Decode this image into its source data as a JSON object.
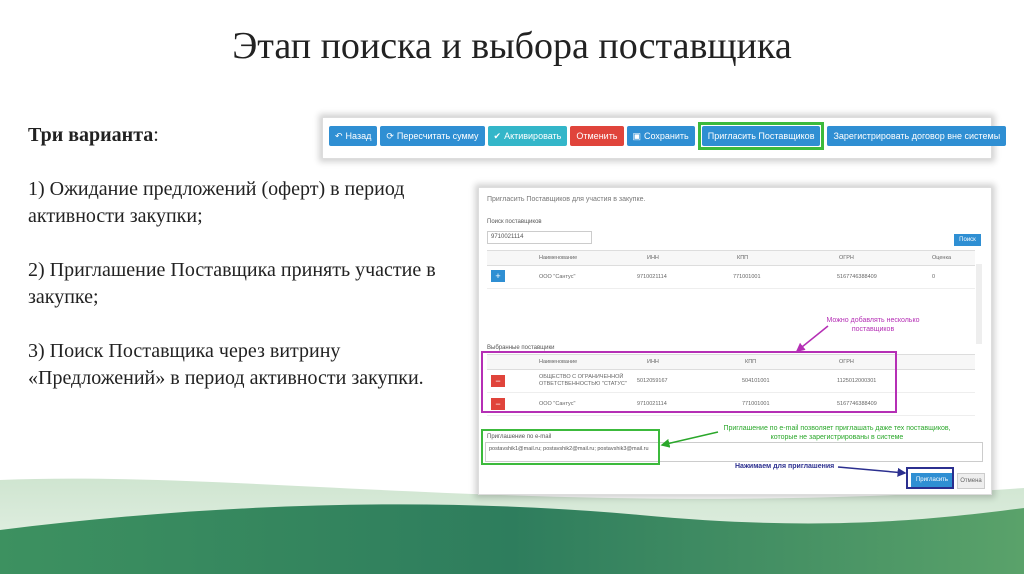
{
  "slide": {
    "title": "Этап поиска и выбора поставщика",
    "heading": "Три варианта",
    "heading_suffix": ":",
    "items": [
      "1) Ожидание предложений (оферт) в период активности закупки;",
      "2) Приглашение Поставщика принять участие в закупке;",
      "3) Поиск Поставщика через витрину «Предложений» в период активности закупки."
    ]
  },
  "toolbar": {
    "back": "Назад",
    "recalc": "Пересчитать сумму",
    "activate": "Активировать",
    "cancel": "Отменить",
    "save": "Сохранить",
    "invite": "Пригласить Поставщиков",
    "register": "Зарегистрировать договор вне системы"
  },
  "dialog": {
    "title": "Пригласить Поставщиков для участия в закупке.",
    "search_label": "Поиск поставщиков",
    "search_value": "9710021114",
    "search_button": "Поиск",
    "columns": [
      "Наименование",
      "ИНН",
      "КПП",
      "ОГРН",
      "Оценка"
    ],
    "results": [
      {
        "name": "ООО \"Сантус\"",
        "inn": "9710021114",
        "kpp": "771001001",
        "ogrn": "5167746388409",
        "score": "0"
      }
    ],
    "selected_label": "Выбранные поставщики",
    "selected_columns": [
      "Наименование",
      "ИНН",
      "КПП",
      "ОГРН"
    ],
    "selected": [
      {
        "name_line1": "ОБЩЕСТВО С ОГРАНИЧЕННОЙ",
        "name_line2": "ОТВЕТСТВЕННОСТЬЮ \"СТАТУС\"",
        "inn": "5012059167",
        "kpp": "504101001",
        "ogrn": "1125012000301"
      },
      {
        "name_line1": "ООО \"Сантус\"",
        "name_line2": "",
        "inn": "9710021114",
        "kpp": "771001001",
        "ogrn": "5167746388409"
      }
    ],
    "email_label": "Приглашение по e-mail",
    "email_value": "postavshik1@mail.ru; postavshik2@mail.ru; postavshik3@mail.ru",
    "invite_button": "Пригласить",
    "cancel_button": "Отмена"
  },
  "annotations": {
    "add_several": "Можно добавлять несколько поставщиков",
    "email_note": "Приглашение по e-mail позволяет приглашать даже тех поставщиков, которые не зарегистрированы в системе",
    "press_to_invite": "Нажимаем для приглашения"
  },
  "colors": {
    "primary_blue": "#2f8fd3",
    "teal": "#33b6c9",
    "red": "#e0443b",
    "green_highlight": "#3cba3c",
    "purple_highlight": "#b52fb5",
    "navy_highlight": "#2b2f8f",
    "wave_green": "#3a8a5a"
  },
  "icons": {
    "back": "undo-icon",
    "recalc": "refresh-icon",
    "activate": "check-icon",
    "save": "floppy-icon",
    "add": "plus-icon",
    "remove": "minus-icon"
  }
}
